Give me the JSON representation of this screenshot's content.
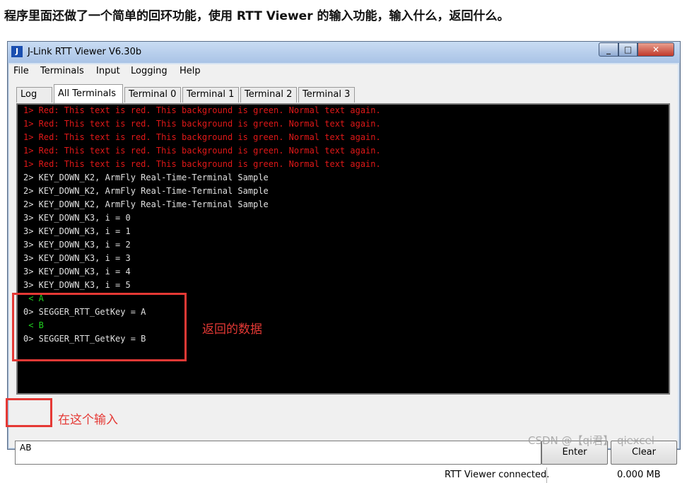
{
  "caption": "程序里面还做了一个简单的回环功能，使用 RTT Viewer 的输入功能，输入什么，返回什么。",
  "window": {
    "title": "J-Link RTT Viewer V6.30b",
    "app_icon": "jlink-icon",
    "controls": [
      "minimize-icon",
      "maximize-icon",
      "close-icon"
    ]
  },
  "menu": [
    "File",
    "Terminals",
    "Input",
    "Logging",
    "Help"
  ],
  "tabs": [
    "Log",
    "All Terminals",
    "Terminal 0",
    "Terminal 1",
    "Terminal 2",
    "Terminal 3"
  ],
  "active_tab": "All Terminals",
  "terminal": {
    "lines": [
      {
        "text": "1> Red: This text is red. This background is green. Normal text again.",
        "color": "red"
      },
      {
        "text": "1> Red: This text is red. This background is green. Normal text again.",
        "color": "red"
      },
      {
        "text": "1> Red: This text is red. This background is green. Normal text again.",
        "color": "red"
      },
      {
        "text": "1> Red: This text is red. This background is green. Normal text again.",
        "color": "red"
      },
      {
        "text": "1> Red: This text is red. This background is green. Normal text again.",
        "color": "red"
      },
      {
        "text": "2> KEY_DOWN_K2, ArmFly Real-Time-Terminal Sample",
        "color": "white"
      },
      {
        "text": "2> KEY_DOWN_K2, ArmFly Real-Time-Terminal Sample",
        "color": "white"
      },
      {
        "text": "2> KEY_DOWN_K2, ArmFly Real-Time-Terminal Sample",
        "color": "white"
      },
      {
        "text": "3> KEY_DOWN_K3, i = 0",
        "color": "white"
      },
      {
        "text": "3> KEY_DOWN_K3, i = 1",
        "color": "white"
      },
      {
        "text": "3> KEY_DOWN_K3, i = 2",
        "color": "white"
      },
      {
        "text": "3> KEY_DOWN_K3, i = 3",
        "color": "white"
      },
      {
        "text": "3> KEY_DOWN_K3, i = 4",
        "color": "white"
      },
      {
        "text": "3> KEY_DOWN_K3, i = 5",
        "color": "white"
      },
      {
        "text": " < A",
        "color": "green"
      },
      {
        "text": "0> SEGGER_RTT_GetKey = A",
        "color": "white"
      },
      {
        "text": " < B",
        "color": "green"
      },
      {
        "text": "0> SEGGER_RTT_GetKey = B",
        "color": "white"
      }
    ]
  },
  "annotations": {
    "returned_data": "返回的数据",
    "input_here": "在这个输入"
  },
  "input": {
    "value": "AB"
  },
  "buttons": {
    "enter": "Enter",
    "clear": "Clear"
  },
  "status": {
    "connection": "RTT Viewer connected.",
    "size": "0.000 MB"
  },
  "watermark": "CSDN @【qi君】 qiexcel",
  "colors": {
    "red": "#e01818",
    "green": "#1fd21f",
    "annotation": "#e53935",
    "terminal_bg": "#000000"
  }
}
